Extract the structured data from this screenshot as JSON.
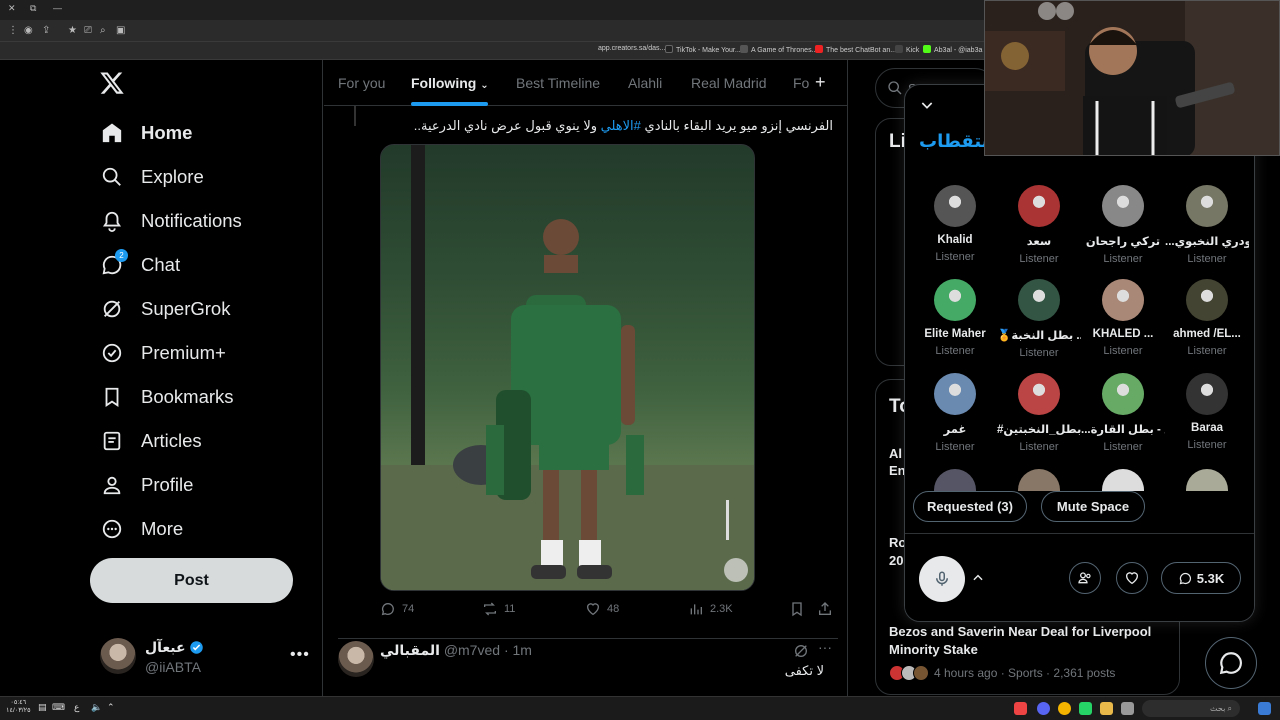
{
  "browser": {
    "bookmarks": [
      "app.creators.sa/das...",
      "TikTok - Make Your...",
      "A Game of Thrones...",
      "The best ChatBot an...",
      "Kick",
      "Ab3al - @iab3a"
    ]
  },
  "nav": {
    "items": [
      {
        "label": "Home",
        "icon": "home-icon",
        "active": true
      },
      {
        "label": "Explore",
        "icon": "search-icon"
      },
      {
        "label": "Notifications",
        "icon": "bell-icon"
      },
      {
        "label": "Chat",
        "icon": "chat-icon",
        "badge": "2"
      },
      {
        "label": "SuperGrok",
        "icon": "grok-icon"
      },
      {
        "label": "Premium+",
        "icon": "premium-icon"
      },
      {
        "label": "Bookmarks",
        "icon": "bookmark-icon"
      },
      {
        "label": "Articles",
        "icon": "article-icon"
      },
      {
        "label": "Profile",
        "icon": "person-icon"
      },
      {
        "label": "More",
        "icon": "more-circle-icon"
      }
    ],
    "post_label": "Post",
    "account": {
      "name": "عبعآل",
      "handle": "@iiABTA"
    }
  },
  "timeline": {
    "tabs": [
      "For you",
      "Following",
      "Best Timeline",
      "Alahli",
      "Real Madrid",
      "Fo"
    ],
    "active_tab": "Following",
    "tweet": {
      "text_before": "الفرنسي إنزو ميو يريد البقاء بالنادي ",
      "hashtag": "#الاهلي",
      "text_after": " ولا ينوي قبول عرض نادي الدرعية..",
      "replies": "74",
      "reposts": "11",
      "likes": "48",
      "views": "2.3K"
    },
    "tweet2": {
      "name": "المقبالي",
      "handle": "@m7ved",
      "time": "· 1m",
      "text": "لا تكفى"
    }
  },
  "sidebar": {
    "search_placeholder": "S",
    "card1_title": "Li",
    "card2_title": "To",
    "trend": {
      "title": "Bezos and Saverin Near Deal for Liverpool Minority Stake",
      "meta": "4 hours ago · Sports · 2,361 posts"
    },
    "partial": [
      "Al",
      "En",
      "Ro",
      "20"
    ]
  },
  "space": {
    "title": "استقطاب",
    "listeners": [
      {
        "name": "Khalid",
        "role": "Listener",
        "color": "#555"
      },
      {
        "name": "سعد",
        "role": "Listener",
        "color": "#a33"
      },
      {
        "name": "تركي راجحان",
        "role": "Listener",
        "color": "#888"
      },
      {
        "name": "...رودري النخبوي",
        "role": "Listener",
        "color": "#776"
      },
      {
        "name": "Elite Maher",
        "role": "Listener",
        "color": "#4a6"
      },
      {
        "name": "🏅بطل النخبة ...",
        "role": "Listener",
        "color": "#354"
      },
      {
        "name": "KHALED ...",
        "role": "Listener",
        "color": "#a87"
      },
      {
        "name": "ahmed /EL...",
        "role": "Listener",
        "color": "#443"
      },
      {
        "name": "غمر",
        "role": "Listener",
        "color": "#6a8ab0"
      },
      {
        "name": "#بطل_النخبتين ...",
        "role": "Listener",
        "color": "#b44"
      },
      {
        "name": "...ل - بطل القارة",
        "role": "Listener",
        "color": "#6a6"
      },
      {
        "name": "Baraa",
        "role": "Listener",
        "color": "#333"
      }
    ],
    "requested_label": "Requested (3)",
    "mute_label": "Mute Space",
    "comments_count": "5.3K"
  },
  "taskbar": {
    "time": "٠٥:٤٦",
    "date": "١٤/٠٣/٢٥",
    "lang": "ع",
    "search_placeholder": "بحث"
  }
}
